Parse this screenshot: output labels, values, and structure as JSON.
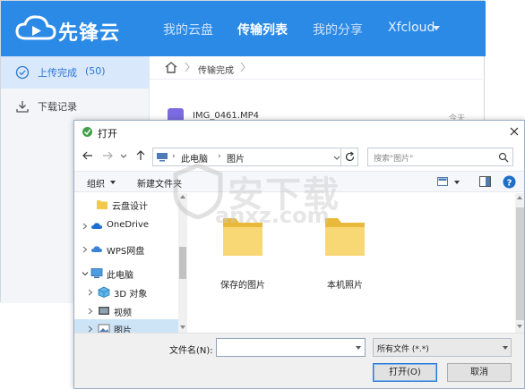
{
  "app": {
    "brand": "先锋云",
    "nav": [
      "我的云盘",
      "传输列表",
      "我的分享"
    ],
    "active_nav": "传输列表",
    "user": "Xfcloud",
    "sidebar": [
      {
        "label": "上传完成",
        "count": "(50)"
      },
      {
        "label": "下载记录",
        "count": ""
      }
    ],
    "breadcrumb": "传输完成",
    "file": {
      "name": "IMG_0461.MP4",
      "time": "今天"
    },
    "colors": {
      "header": "#2a8ae6",
      "accent": "#2a78d6"
    }
  },
  "dialog": {
    "title": "打开",
    "address": [
      "此电脑",
      "图片"
    ],
    "search_placeholder": "搜索\"图片\"",
    "toolbar": {
      "organize": "组织",
      "new_folder": "新建文件夹"
    },
    "tree": [
      {
        "label": "云盘设计",
        "icon": "folder-icon"
      },
      {
        "label": "OneDrive",
        "icon": "cloud-icon"
      },
      {
        "label": "WPS网盘",
        "icon": "cloud-icon"
      },
      {
        "label": "此电脑",
        "icon": "computer-icon"
      },
      {
        "label": "3D 对象",
        "icon": "cube-icon"
      },
      {
        "label": "视频",
        "icon": "video-icon"
      },
      {
        "label": "图片",
        "icon": "picture-icon"
      }
    ],
    "folders": [
      "保存的图片",
      "本机照片"
    ],
    "filename_label": "文件名(N):",
    "filename_value": "",
    "filetype": "所有文件 (*.*)",
    "open_button": "打开(O)",
    "cancel_button": "取消"
  },
  "watermark": {
    "text": "安下载",
    "sub": "anxz.com"
  }
}
